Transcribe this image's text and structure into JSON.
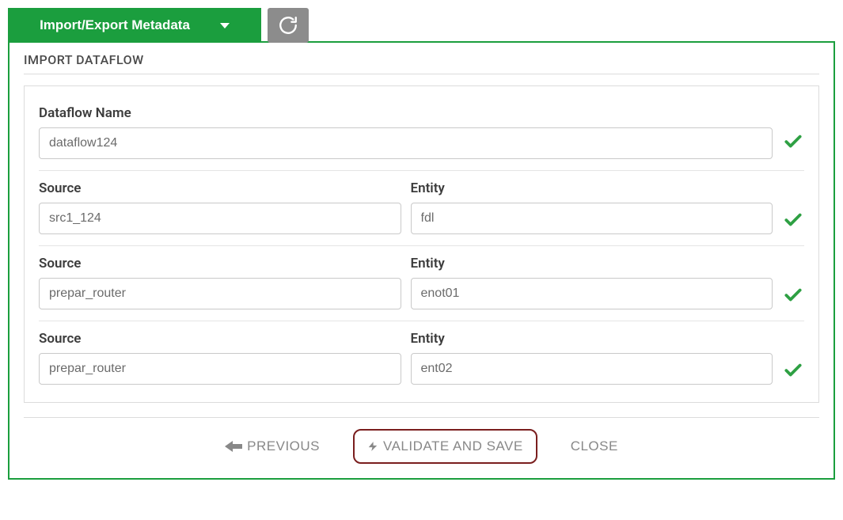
{
  "topbar": {
    "import_export_label": "Import/Export Metadata"
  },
  "panel": {
    "title": "IMPORT DATAFLOW"
  },
  "form": {
    "dataflow_name": {
      "label": "Dataflow Name",
      "value": "dataflow124",
      "valid": true
    },
    "rows": [
      {
        "source_label": "Source",
        "source_value": "src1_124",
        "entity_label": "Entity",
        "entity_value": "fdl",
        "valid": true
      },
      {
        "source_label": "Source",
        "source_value": "prepar_router",
        "entity_label": "Entity",
        "entity_value": "enot01",
        "valid": true
      },
      {
        "source_label": "Source",
        "source_value": "prepar_router",
        "entity_label": "Entity",
        "entity_value": "ent02",
        "valid": true
      }
    ]
  },
  "footer": {
    "previous_label": "PREVIOUS",
    "validate_label": "VALIDATE AND SAVE",
    "close_label": "CLOSE"
  }
}
